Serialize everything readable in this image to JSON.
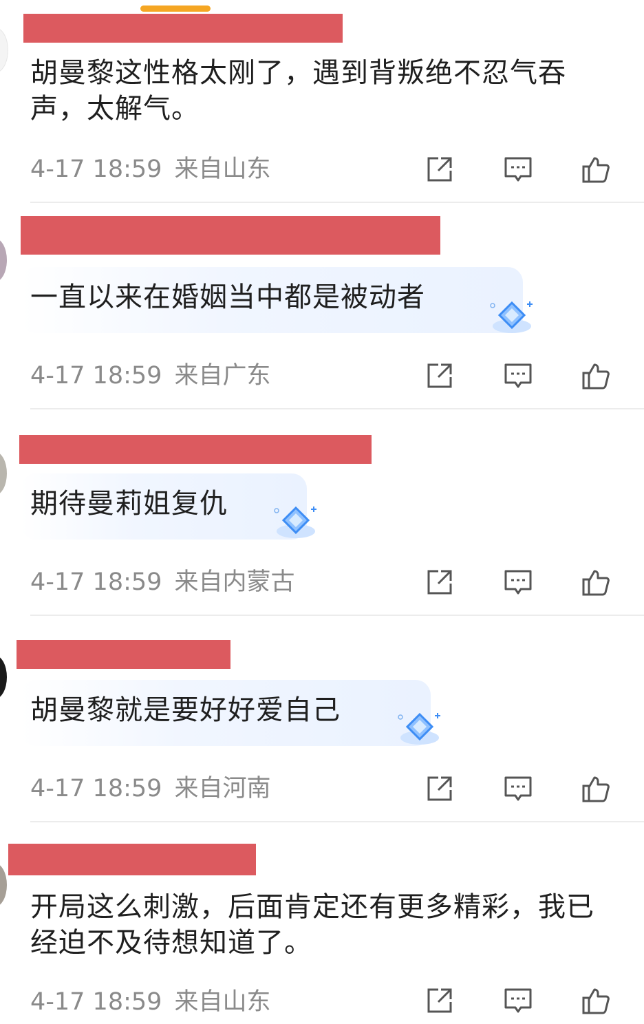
{
  "comments": [
    {
      "text": "胡曼黎这性格太刚了，遇到背叛绝不忍气吞声，太解气。",
      "time": "4-17 18:59",
      "location": "来自山东"
    },
    {
      "text": "一直以来在婚姻当中都是被动者",
      "time": "4-17 18:59",
      "location": "来自广东"
    },
    {
      "text": "期待曼莉姐复仇",
      "time": "4-17 18:59",
      "location": "来自内蒙古"
    },
    {
      "text": "胡曼黎就是要好好爱自己",
      "time": "4-17 18:59",
      "location": "来自河南"
    },
    {
      "text": "开局这么刺激，后面肯定还有更多精彩，我已经迫不及待想知道了。",
      "time": "4-17 18:59",
      "location": "来自山东"
    }
  ],
  "colors": {
    "redaction": "#dc5a5f",
    "accent": "#f5a623",
    "meta_text": "#8a8a8a",
    "icon": "#555555",
    "bubble": "#eaf2ff"
  },
  "icons": {
    "share": "share-icon",
    "reply": "comment-icon",
    "like": "thumbs-up-icon",
    "badge": "diamond-badge-icon"
  }
}
